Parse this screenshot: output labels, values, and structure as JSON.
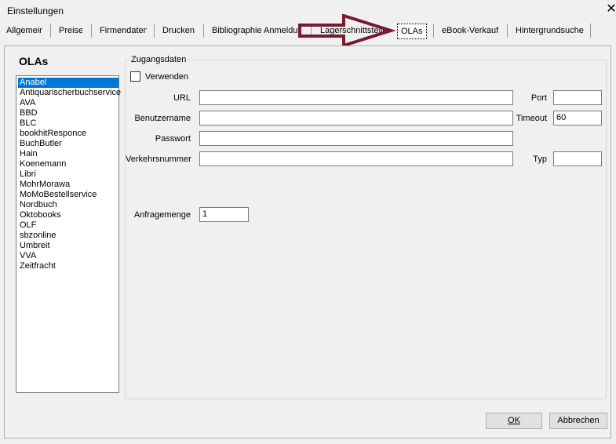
{
  "window": {
    "title": "Einstellungen",
    "close": "✕"
  },
  "tabs": [
    "Allgemein",
    "Preise",
    "Firmendaten",
    "Drucken",
    "Bibliographie Anmeldung",
    "Lagerschnittstelle",
    "OLAs",
    "eBook-Verkauf",
    "Hintergrundsuche"
  ],
  "active_tab": "OLAs",
  "sidebar": {
    "heading": "OLAs",
    "items": [
      "Anabel",
      "Antiquarischerbuchservice",
      "AVA",
      "BBD",
      "BLC",
      "bookhitResponce",
      "BuchButler",
      "Hain",
      "Koenemann",
      "Libri",
      "MohrMorawa",
      "MoMoBestellservice",
      "Nordbuch",
      "Oktobooks",
      "OLF",
      "sbzonline",
      "Umbreit",
      "VVA",
      "Zeitfracht"
    ],
    "selected": "Anabel"
  },
  "group": {
    "label": "Zugangsdaten",
    "verwenden_label": "Verwenden",
    "verwenden_checked": false,
    "url_label": "URL",
    "url_value": "",
    "port_label": "Port",
    "port_value": "",
    "benutzername_label": "Benutzername",
    "benutzername_value": "",
    "timeout_label": "Timeout",
    "timeout_value": "60",
    "passwort_label": "Passwort",
    "passwort_value": "",
    "verkehrsnummer_label": "Verkehrsnummer",
    "verkehrsnummer_value": "",
    "typ_label": "Typ",
    "typ_value": "",
    "anfragemenge_label": "Anfragemenge",
    "anfragemenge_value": "1"
  },
  "buttons": {
    "ok": "OK",
    "cancel": "Abbrechen"
  },
  "colors": {
    "arrow": "#7a1a2e",
    "selection": "#0078d7"
  }
}
